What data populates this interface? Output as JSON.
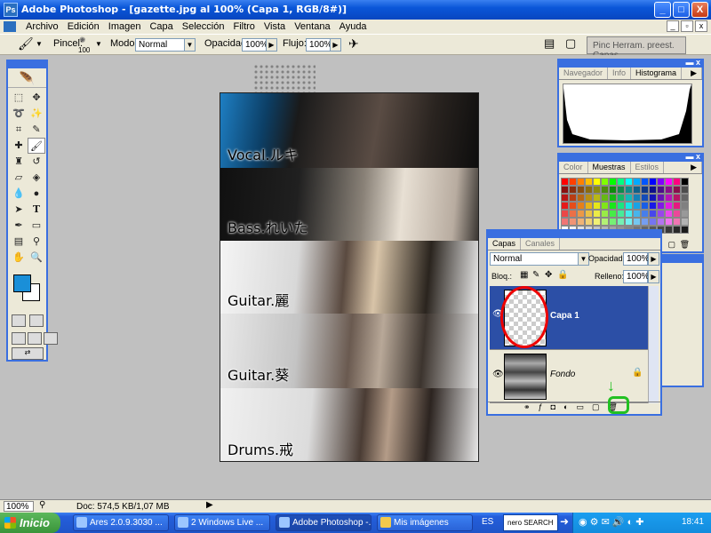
{
  "window": {
    "title": "Adobe Photoshop - [gazette.jpg al 100% (Capa 1, RGB/8#)]",
    "min": "_",
    "max": "□",
    "close": "X"
  },
  "menubar": {
    "items": [
      "Archivo",
      "Edición",
      "Imagen",
      "Capa",
      "Selección",
      "Filtro",
      "Vista",
      "Ventana",
      "Ayuda"
    ]
  },
  "options": {
    "brush_label": "Pincel:",
    "brush_size": "100",
    "mode_label": "Modo:",
    "mode_value": "Normal",
    "opacity_label": "Opacidad:",
    "opacity_value": "100%",
    "flow_label": "Flujo:",
    "flow_value": "100%",
    "well_tabs": "Pinc  Herram. preest.  Capas"
  },
  "canvas": {
    "labels": [
      "Vocal.ルキ",
      "Bass.れいた",
      "Guitar.麗",
      "Guitar.葵",
      "Drums.戒"
    ]
  },
  "navigator_panel": {
    "tabs": [
      "Navegador",
      "Info",
      "Histograma"
    ],
    "active_tab": "Histograma"
  },
  "swatches_panel": {
    "tabs": [
      "Color",
      "Muestras",
      "Estilos"
    ],
    "active_tab": "Muestras"
  },
  "layers_panel": {
    "tabs": [
      "Capas",
      "Canales"
    ],
    "blend_mode": "Normal",
    "opacity_label": "Opacidad:",
    "opacity_value": "100%",
    "lock_label": "Bloq.:",
    "fill_label": "Relleno:",
    "fill_value": "100%",
    "layers": [
      {
        "name": "Capa 1",
        "selected": true
      },
      {
        "name": "Fondo",
        "selected": false,
        "locked": true
      }
    ]
  },
  "statusbar": {
    "zoom": "100%",
    "doc": "Doc: 574,5 KB/1,07 MB"
  },
  "taskbar": {
    "start": "Inicio",
    "tasks": [
      {
        "label": "Ares 2.0.9.3030 ...",
        "active": false
      },
      {
        "label": "2 Windows Live ...",
        "active": false
      },
      {
        "label": "Adobe Photoshop -...",
        "active": true
      },
      {
        "label": "Mis imágenes",
        "active": false
      }
    ],
    "lang": "ES",
    "search": "nero SEARCH",
    "clock": "18:41"
  },
  "colors": {
    "foreground": "#1a8fd8",
    "background": "#ffffff",
    "selection": "#2c4fa6",
    "annotation": "#e00000"
  }
}
